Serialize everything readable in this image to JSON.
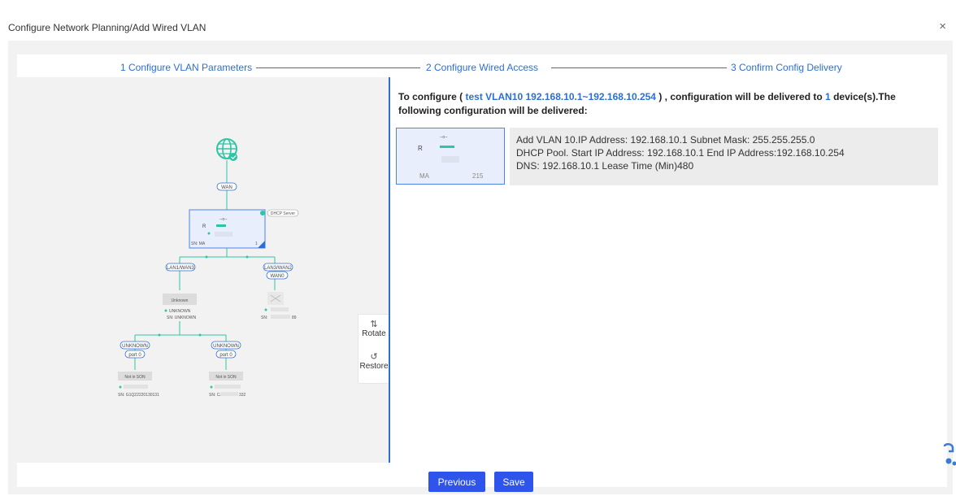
{
  "modal": {
    "title": "Configure Network Planning/Add Wired VLAN",
    "close_glyph": "×"
  },
  "steps": [
    {
      "label": "1 Configure VLAN Parameters"
    },
    {
      "label": "2 Configure Wired Access"
    },
    {
      "label": "3 Confirm Config Delivery"
    }
  ],
  "topology": {
    "wan_label": "WAN",
    "router": {
      "letter": "R",
      "model": "--o--",
      "sn": "SN: MA",
      "sn_tail": "1",
      "badge": "DHCP Server"
    },
    "ports": [
      "LAN1/WAN3",
      "LAN3/WAN2",
      "WAN0"
    ],
    "unknown_switch": {
      "name": "Unknown",
      "status": "UNKNOWN",
      "sn": "SN: UNKNOWN"
    },
    "ap_device": {
      "sn": "SN: ",
      "sn_tail": "89"
    },
    "leaf_left": {
      "port_name": "UNKNOWN",
      "port": "port 0",
      "status": "Not in SON",
      "sn": "SN: G1Q22220130131"
    },
    "leaf_right": {
      "port_name": "UNKNOWN",
      "port": "port 0",
      "status": "Not in SON",
      "sn": "SN: CA",
      "sn_tail": "332"
    }
  },
  "tools": {
    "rotate": "Rotate",
    "restore": "Restore"
  },
  "summary": {
    "prefix": "To configure",
    "vlan": "test VLAN10 192.168.10.1~192.168.10.254",
    "middle": ", configuration will be delivered to",
    "count": "1",
    "suffix": "device(s).The following configuration will be delivered:"
  },
  "device_card": {
    "model": "--o--",
    "letter": "R",
    "sn_prefix": "MA",
    "sn_tail": "215"
  },
  "config_lines": [
    "Add VLAN 10.IP Address: 192.168.10.1 Subnet Mask: 255.255.255.0",
    "DHCP Pool. Start IP Address: 192.168.10.1 End IP Address:192.168.10.254",
    "DNS: 192.168.10.1 Lease Time (Min)480"
  ],
  "footer": {
    "previous": "Previous",
    "save": "Save"
  },
  "colors": {
    "accent": "#2b6fd6",
    "primary_button": "#2f54eb",
    "online_dot": "#2ec4a6"
  },
  "icons": [
    "globe-icon",
    "check-icon",
    "rotate-icon",
    "restore-icon",
    "close-icon",
    "assistant-icon"
  ]
}
